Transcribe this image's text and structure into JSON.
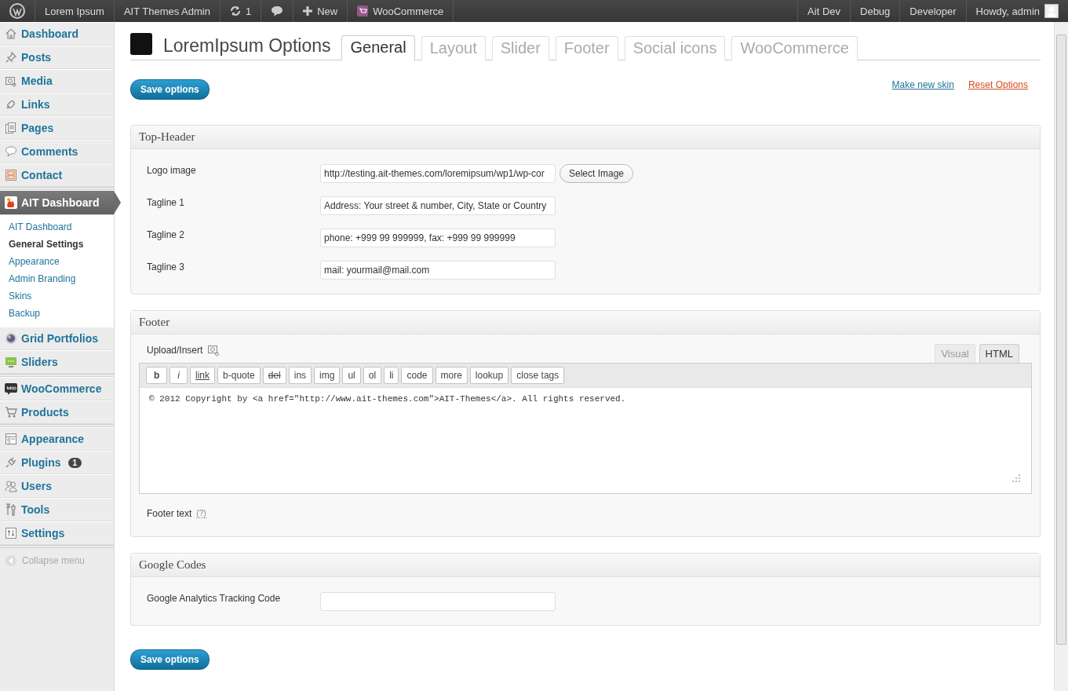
{
  "admin_bar": {
    "left": [
      {
        "kind": "logo"
      },
      {
        "kind": "text",
        "label": "Lorem Ipsum"
      },
      {
        "kind": "text",
        "label": "AIT Themes Admin"
      },
      {
        "kind": "updates",
        "label": "1"
      },
      {
        "kind": "comments"
      },
      {
        "kind": "new",
        "label": "New"
      },
      {
        "kind": "woo",
        "label": "WooCommerce"
      }
    ],
    "right": [
      {
        "kind": "text",
        "label": "Ait Dev"
      },
      {
        "kind": "text",
        "label": "Debug"
      },
      {
        "kind": "text",
        "label": "Developer"
      },
      {
        "kind": "account",
        "label": "Howdy, admin"
      }
    ]
  },
  "sidebar": {
    "groups": [
      [
        {
          "label": "Dashboard",
          "selected": false
        },
        {
          "label": "Posts",
          "selected": false
        },
        {
          "label": "Media",
          "selected": false
        },
        {
          "label": "Links",
          "selected": false
        },
        {
          "label": "Pages",
          "selected": false
        },
        {
          "label": "Comments",
          "selected": false
        },
        {
          "label": "Contact",
          "selected": false
        }
      ],
      [
        {
          "label": "AIT Dashboard",
          "selected": true,
          "submenu": [
            {
              "label": "AIT Dashboard",
              "selected": false
            },
            {
              "label": "General Settings",
              "selected": true
            },
            {
              "label": "Appearance",
              "selected": false
            },
            {
              "label": "Admin Branding",
              "selected": false
            },
            {
              "label": "Skins",
              "selected": false
            },
            {
              "label": "Backup",
              "selected": false
            }
          ]
        },
        {
          "label": "Grid Portfolios",
          "selected": false
        },
        {
          "label": "Sliders",
          "selected": false
        }
      ],
      [
        {
          "label": "WooCommerce",
          "selected": false
        },
        {
          "label": "Products",
          "selected": false
        }
      ],
      [
        {
          "label": "Appearance",
          "selected": false
        },
        {
          "label": "Plugins",
          "selected": false,
          "badge": "1"
        },
        {
          "label": "Users",
          "selected": false
        },
        {
          "label": "Tools",
          "selected": false
        },
        {
          "label": "Settings",
          "selected": false
        }
      ]
    ],
    "collapse": "Collapse menu"
  },
  "page": {
    "title": "LoremIpsum Options",
    "tabs": [
      {
        "label": "General",
        "selected": true
      },
      {
        "label": "Layout",
        "selected": false
      },
      {
        "label": "Slider",
        "selected": false
      },
      {
        "label": "Footer",
        "selected": false
      },
      {
        "label": "Social icons",
        "selected": false
      },
      {
        "label": "WooCommerce",
        "selected": false
      }
    ],
    "save_label": "Save options",
    "links": [
      {
        "label": "Make new skin",
        "kind": "normal"
      },
      {
        "label": "Reset Options",
        "kind": "danger"
      }
    ],
    "sections": [
      {
        "title": "Top-Header",
        "kind": "fields",
        "fields": [
          {
            "label": "Logo image",
            "value": "http://testing.ait-themes.com/loremipsum/wp1/wp-cor",
            "button": "Select Image"
          },
          {
            "label": "Tagline 1",
            "value": "Address: Your street & number, City, State or Country"
          },
          {
            "label": "Tagline 2",
            "value": "phone: +999 99 999999, fax: +999 99 999999"
          },
          {
            "label": "Tagline 3",
            "value": "mail: yourmail@mail.com"
          }
        ]
      },
      {
        "title": "Footer",
        "kind": "editor",
        "upload_label": "Upload/Insert",
        "editor_tabs": [
          {
            "label": "Visual",
            "selected": false
          },
          {
            "label": "HTML",
            "selected": true
          }
        ],
        "toolbar": [
          {
            "label": "b",
            "kind": "bold"
          },
          {
            "label": "i",
            "kind": "italic"
          },
          {
            "label": "link",
            "kind": "underline"
          },
          {
            "label": "b-quote",
            "kind": "plain"
          },
          {
            "label": "del",
            "kind": "strike"
          },
          {
            "label": "ins",
            "kind": "plain"
          },
          {
            "label": "img",
            "kind": "plain"
          },
          {
            "label": "ul",
            "kind": "plain"
          },
          {
            "label": "ol",
            "kind": "plain"
          },
          {
            "label": "li",
            "kind": "plain"
          },
          {
            "label": "code",
            "kind": "plain"
          },
          {
            "label": "more",
            "kind": "plain"
          },
          {
            "label": "lookup",
            "kind": "plain"
          },
          {
            "label": "close tags",
            "kind": "plain"
          }
        ],
        "content": "© 2012 Copyright by <a href=\"http://www.ait-themes.com\">AIT-Themes</a>. All rights reserved.",
        "field_label": "Footer text",
        "help": "(?)"
      },
      {
        "title": "Google Codes",
        "kind": "fields",
        "fields": [
          {
            "label": "Google Analytics Tracking Code"
          }
        ]
      }
    ],
    "bottom_save": "Save options"
  }
}
